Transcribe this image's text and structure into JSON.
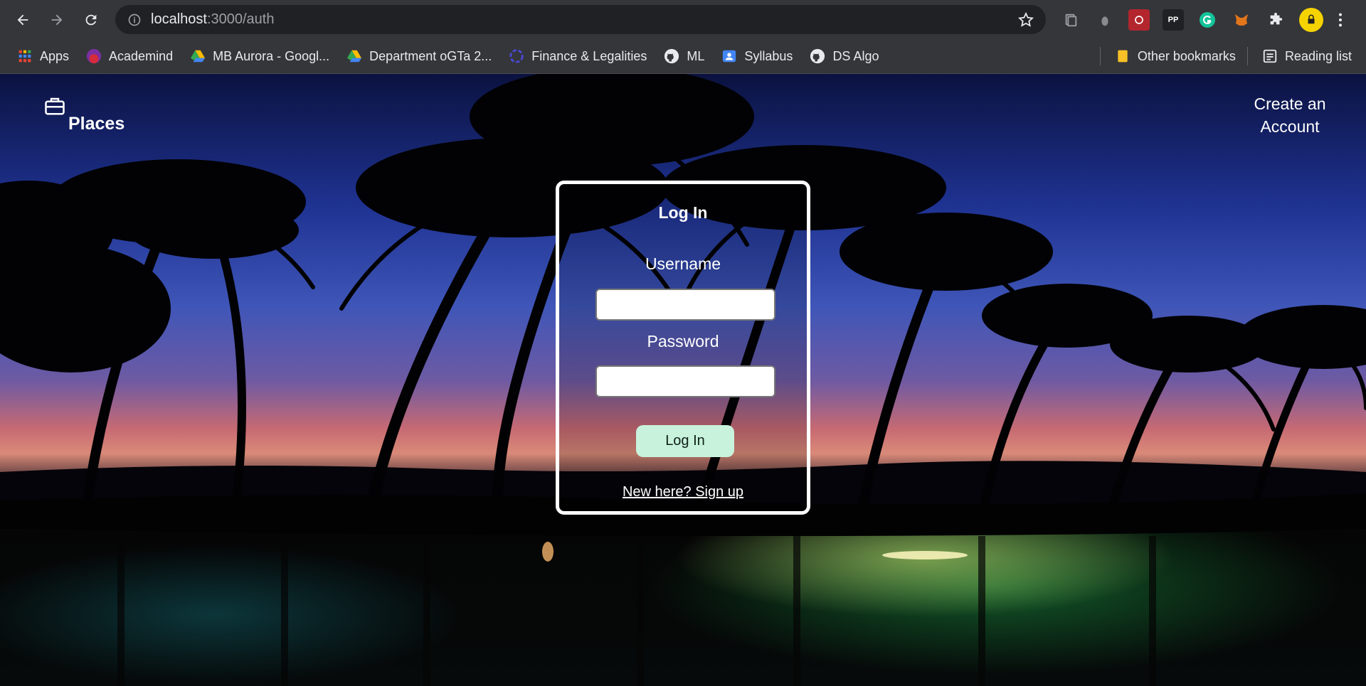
{
  "browser": {
    "url_host": "localhost",
    "url_path": ":3000/auth",
    "bookmarks": [
      {
        "label": "Apps",
        "icon": "apps-grid-icon"
      },
      {
        "label": "Academind",
        "icon": "academind-icon"
      },
      {
        "label": "MB Aurora - Googl...",
        "icon": "google-drive-icon"
      },
      {
        "label": "Department oGTa 2...",
        "icon": "google-drive-icon"
      },
      {
        "label": "Finance & Legalities",
        "icon": "link-icon"
      },
      {
        "label": "ML",
        "icon": "github-icon"
      },
      {
        "label": "Syllabus",
        "icon": "contacts-icon"
      },
      {
        "label": "DS Algo",
        "icon": "github-icon"
      }
    ],
    "other_bookmarks": "Other bookmarks",
    "reading_list": "Reading list",
    "extensions": [
      "pp-extension-icon",
      "grammarly-icon",
      "metamask-icon",
      "puzzle-icon"
    ],
    "ext_pp_label": "PP",
    "avatar_color": "#f5d300"
  },
  "header": {
    "brand": "Places",
    "create_account": "Create an Account"
  },
  "login": {
    "title": "Log In",
    "username_label": "Username",
    "username_value": "",
    "password_label": "Password",
    "password_value": "",
    "submit_label": "Log In",
    "signup_text": "New here? Sign up"
  },
  "colors": {
    "card_border": "#ffffff",
    "button_bg": "#c8f2dc",
    "toolbar_bg": "#35363a"
  }
}
